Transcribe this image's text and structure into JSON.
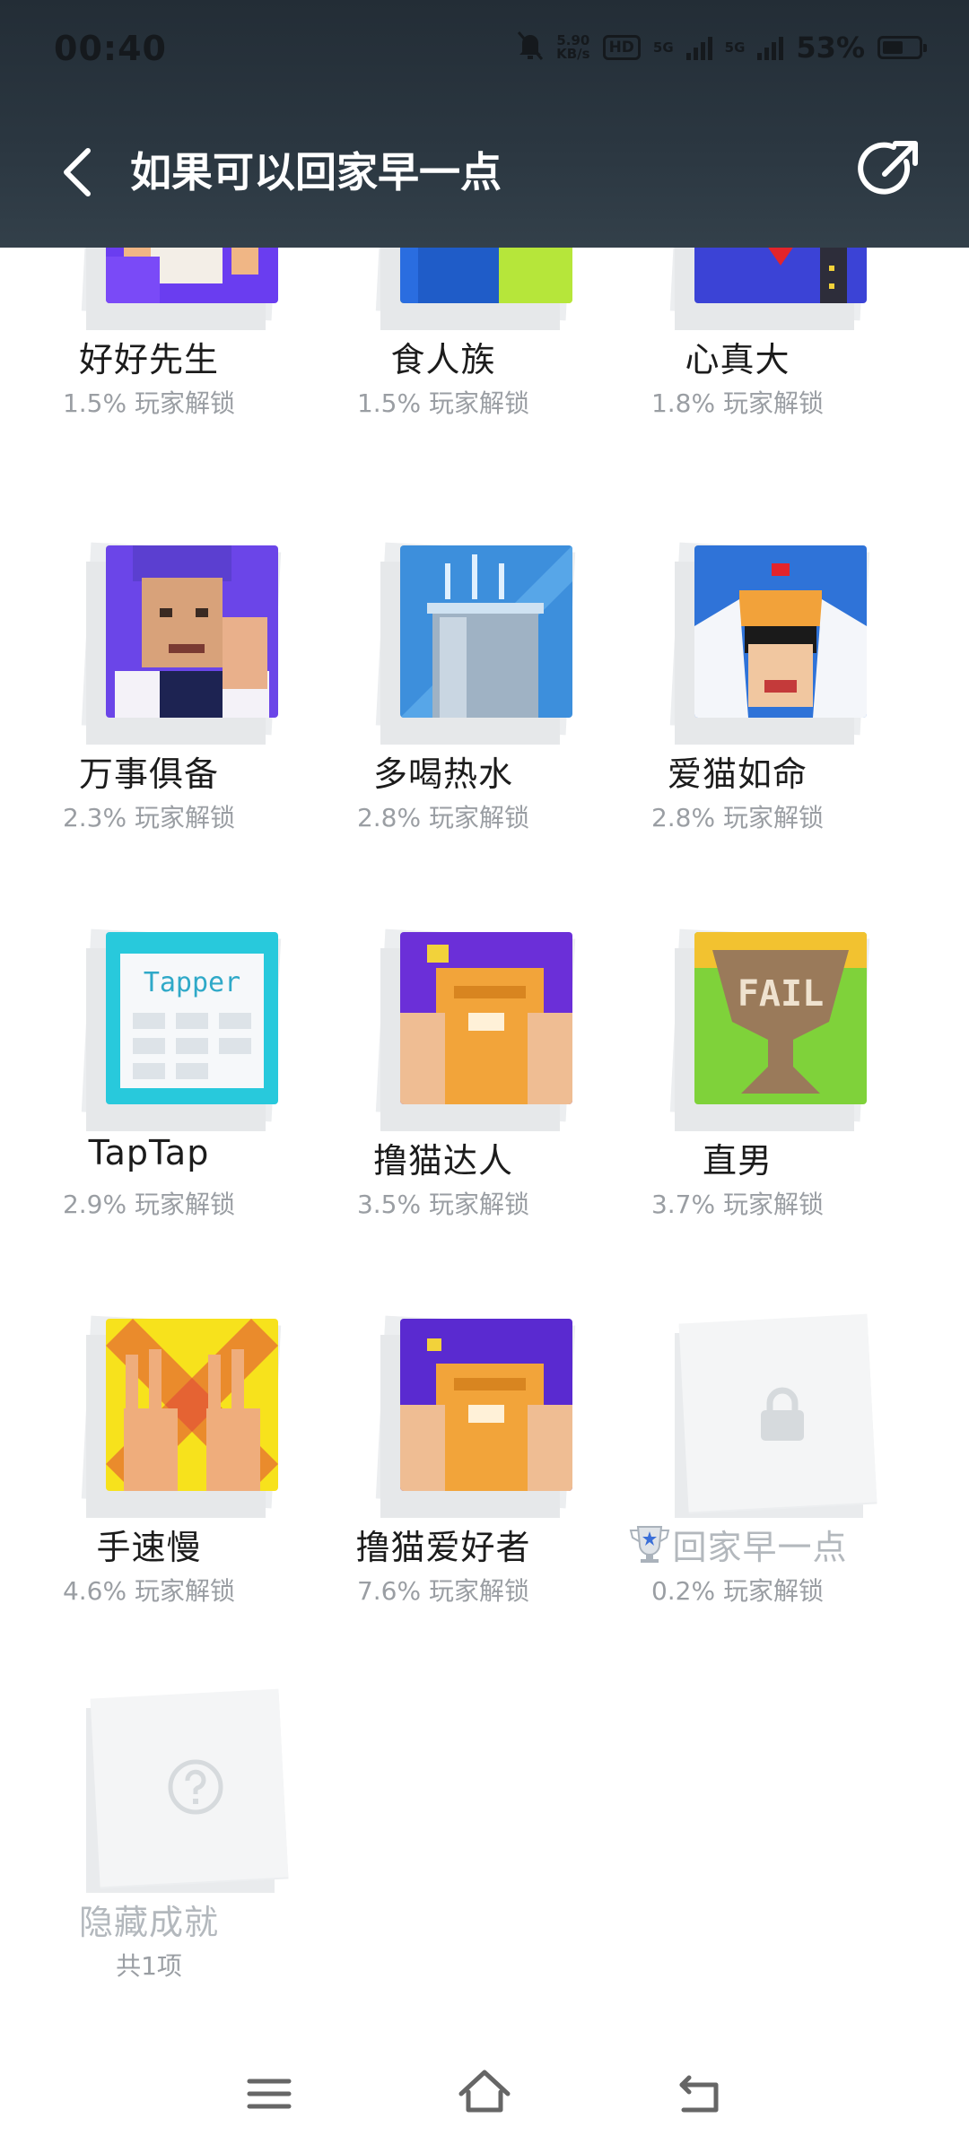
{
  "status_bar": {
    "time": "00:40",
    "net_speed_top": "5.90",
    "net_speed_bottom": "KB/s",
    "hd_tag": "HD",
    "net1": "5G",
    "net2": "5G",
    "battery_pct": "53%"
  },
  "header": {
    "title": "如果可以回家早一点"
  },
  "achievements": [
    {
      "name": "好好先生",
      "stat": "1.5% 玩家解锁",
      "art": "pixel-man-spray-art"
    },
    {
      "name": "食人族",
      "stat": "1.5% 玩家解锁",
      "art": "pixel-cannibal-art"
    },
    {
      "name": "心真大",
      "stat": "1.8% 玩家解锁",
      "art": "pixel-big-heart-art"
    },
    {
      "name": "万事俱备",
      "stat": "2.3% 玩家解锁",
      "art": "pixel-ok-hand-man-art"
    },
    {
      "name": "多喝热水",
      "stat": "2.8% 玩家解锁",
      "art": "pixel-hot-water-glass-art"
    },
    {
      "name": "爱猫如命",
      "stat": "2.8% 玩家解锁",
      "art": "pixel-cat-on-head-art"
    },
    {
      "name": "TapTap",
      "stat": "2.9% 玩家解锁",
      "art": "pixel-tapper-app-art",
      "art_text": "Tapper"
    },
    {
      "name": "撸猫达人",
      "stat": "3.5% 玩家解锁",
      "art": "pixel-petting-cat-art"
    },
    {
      "name": "直男",
      "stat": "3.7% 玩家解锁",
      "art": "pixel-fail-trophy-art",
      "art_text": "FAIL"
    },
    {
      "name": "手速慢",
      "stat": "4.6% 玩家解锁",
      "art": "pixel-peace-hands-art"
    },
    {
      "name": "撸猫爱好者",
      "stat": "7.6% 玩家解锁",
      "art": "pixel-petting-cat-art"
    },
    {
      "name": "回家早一点",
      "stat": "0.2% 玩家解锁",
      "art": "locked",
      "trophy": true
    },
    {
      "name": "隐藏成就",
      "stat": "共1项",
      "art": "hidden"
    }
  ],
  "colors": {
    "header_bg": "#2b3741",
    "text_primary": "#1c1c1c",
    "text_secondary": "#9a9ea3",
    "text_dim": "#b3b8bd"
  }
}
